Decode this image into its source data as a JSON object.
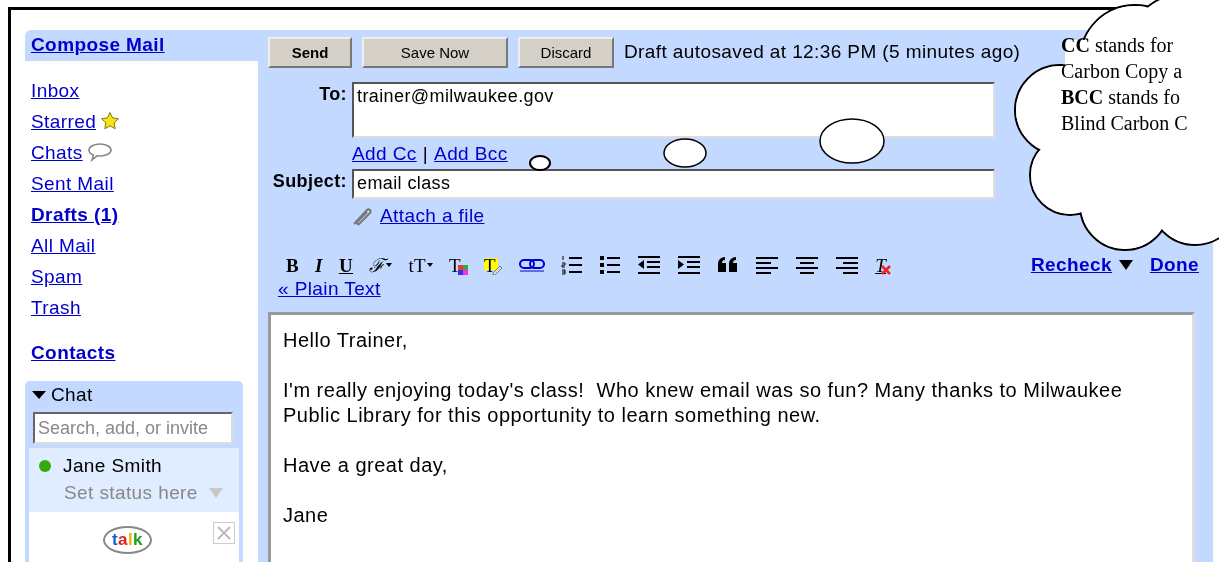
{
  "sidebar": {
    "compose": "Compose Mail",
    "items": [
      {
        "label": "Inbox",
        "kind": "plain",
        "unread": false
      },
      {
        "label": "Starred",
        "kind": "star",
        "unread": false
      },
      {
        "label": "Chats",
        "kind": "bubble",
        "unread": false
      },
      {
        "label": "Sent Mail",
        "kind": "plain",
        "unread": false
      },
      {
        "label": "Drafts (1)",
        "kind": "plain",
        "unread": true
      },
      {
        "label": "All Mail",
        "kind": "plain",
        "unread": false
      },
      {
        "label": "Spam",
        "kind": "plain",
        "unread": false
      },
      {
        "label": "Trash",
        "kind": "plain",
        "unread": false
      }
    ],
    "contacts": "Contacts",
    "chat": {
      "title": "Chat",
      "expanded": true,
      "search": {
        "placeholder": "Search, add, or invite"
      },
      "contacts": [
        {
          "name": "Jane Smith",
          "color": "#33aa11",
          "status": "Set status here"
        }
      ],
      "logo": "talk"
    }
  },
  "compose": {
    "buttons": [
      {
        "label": "Send",
        "primary": true
      },
      {
        "label": "Save Now",
        "primary": false
      },
      {
        "label": "Discard",
        "primary": false
      }
    ],
    "status": "Draft autosaved at 12:36 PM (5 minutes ago)",
    "to": {
      "label": "To:",
      "value": "trainer@milwaukee.gov"
    },
    "cc_links": [
      "Add Cc",
      "Add Bcc"
    ],
    "cc_separator": "|",
    "subject": {
      "label": "Subject:",
      "value": "email class"
    },
    "attach": "Attach a file",
    "toolbar": [
      {
        "kind": "bold",
        "glyph": "B"
      },
      {
        "kind": "italic",
        "glyph": "I"
      },
      {
        "kind": "underline",
        "glyph": "U"
      },
      {
        "kind": "font",
        "glyph": "ℱ"
      },
      {
        "kind": "size",
        "glyph": "tT"
      },
      {
        "kind": "color",
        "glyph": "T"
      },
      {
        "kind": "highlight",
        "glyph": "T"
      },
      {
        "kind": "link"
      },
      {
        "kind": "numbered"
      },
      {
        "kind": "bulleted"
      },
      {
        "kind": "outdent"
      },
      {
        "kind": "indent"
      },
      {
        "kind": "quote"
      },
      {
        "kind": "left"
      },
      {
        "kind": "center"
      },
      {
        "kind": "right"
      },
      {
        "kind": "clear",
        "glyph": "T"
      }
    ],
    "recheck": "Recheck",
    "done": "Done",
    "plain_text": "« Plain Text",
    "body": [
      "Hello Trainer,",
      "I'm really enjoying today's class!  Who knew email was so fun? Many thanks to Milwaukee Public Library for this opportunity to learn something new.",
      "Have a great day,",
      "Jane"
    ]
  },
  "callout": {
    "lines": [
      "**CC** stands for",
      "Carbon Copy a",
      "**BCC** stands fo",
      "Blind Carbon C"
    ]
  }
}
